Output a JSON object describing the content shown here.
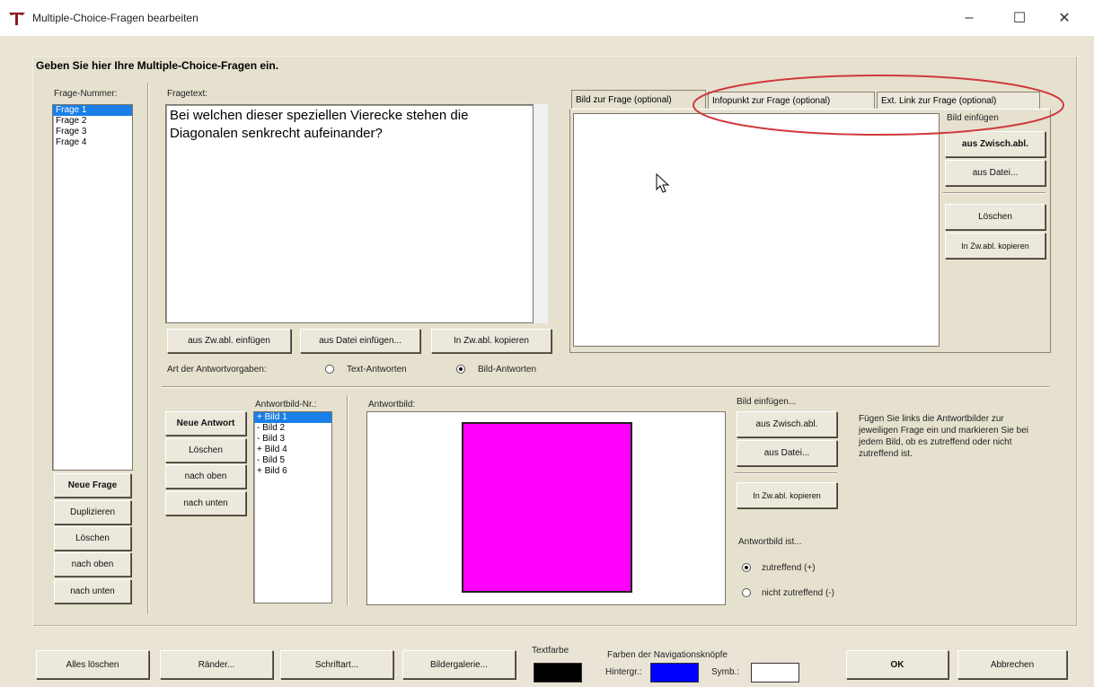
{
  "window": {
    "title": "Multiple-Choice-Fragen bearbeiten",
    "minimize": "–",
    "maximize": "☐",
    "close": "✕"
  },
  "heading": "Geben Sie hier Ihre Multiple-Choice-Fragen ein.",
  "questions": {
    "label": "Frage-Nummer:",
    "items": [
      "Frage 1",
      "Frage 2",
      "Frage 3",
      "Frage 4"
    ],
    "selected_index": 0,
    "buttons": [
      "Neue Frage",
      "Duplizieren",
      "Löschen",
      "nach oben",
      "nach unten"
    ]
  },
  "fragetext": {
    "label": "Fragetext:",
    "value": "Bei welchen dieser speziellen Vierecke stehen die Diagonalen senkrecht aufeinander?",
    "buttons": [
      "aus Zw.abl. einfügen",
      "aus Datei einfügen...",
      "In Zw.abl. kopieren"
    ]
  },
  "tabs": [
    "Bild zur Frage (optional)",
    "Infopunkt zur Frage (optional)",
    "Ext. Link zur Frage (optional)"
  ],
  "bild_panel": {
    "label": "Bild einfügen",
    "buttons": [
      "aus Zwisch.abl.",
      "aus Datei...",
      "Löschen",
      "In Zw.abl. kopieren"
    ]
  },
  "antwortart": {
    "label": "Art der Antwortvorgaben:",
    "options": [
      "Text-Antworten",
      "Bild-Antworten"
    ],
    "selected": "Bild-Antworten"
  },
  "antworten": {
    "buttons": [
      "Neue Antwort",
      "Löschen",
      "nach oben",
      "nach unten"
    ],
    "list_label": "Antwortbild-Nr.:",
    "items": [
      "+ Bild 1",
      "- Bild 2",
      "- Bild 3",
      "+ Bild 4",
      "- Bild 5",
      "+ Bild 6"
    ],
    "selected_index": 0,
    "image_label": "Antwortbild:",
    "image_fill": "#ff00ff"
  },
  "antwortbild_panel": {
    "label": "Bild einfügen...",
    "buttons": [
      "aus Zwisch.abl.",
      "aus Datei...",
      "In Zw.abl. kopieren"
    ],
    "hint": "Fügen Sie links die Antwortbilder zur jeweiligen Frage ein und markieren Sie bei jedem Bild, ob es zutreffend oder nicht zutreffend ist.",
    "status_label": "Antwortbild ist...",
    "options": [
      "zutreffend (+)",
      "nicht zutreffend (-)"
    ],
    "selected": "zutreffend (+)"
  },
  "bottom": {
    "buttons": [
      "Alles löschen",
      "Ränder...",
      "Schriftart...",
      "Bildergalerie..."
    ],
    "textfarbe_label": "Textfarbe",
    "textfarbe_color": "#000000",
    "nav_label": "Farben der Navigationsknöpfe",
    "hintergr_label": "Hintergr.:",
    "hintergr_color": "#0000ff",
    "symb_label": "Symb.:",
    "symb_color": "#ffffff",
    "ok": "OK",
    "cancel": "Abbrechen"
  }
}
